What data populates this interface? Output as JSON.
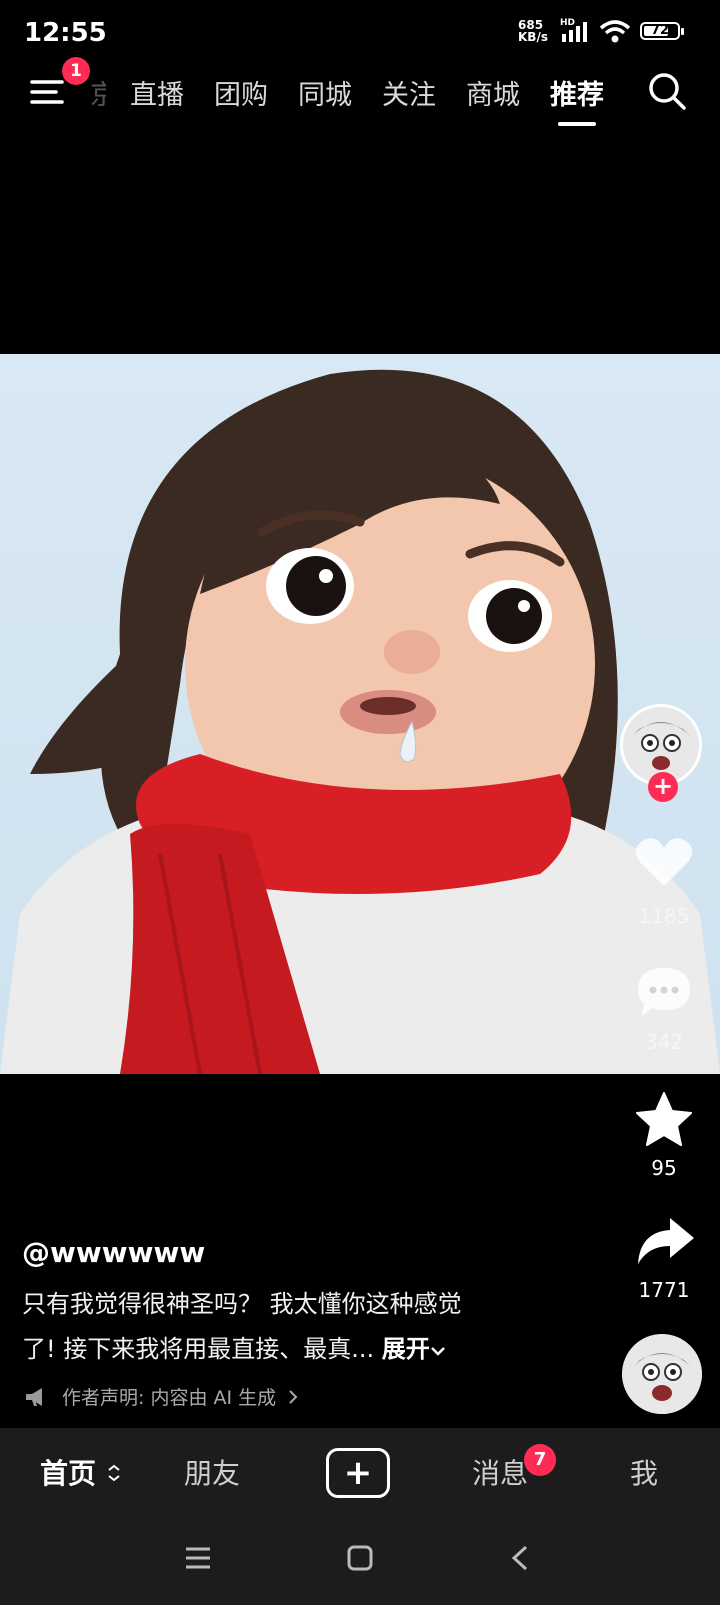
{
  "status": {
    "time": "12:55",
    "net_speed_top": "685",
    "net_speed_bottom": "KB/s",
    "hd": "HD",
    "battery": "72"
  },
  "top_nav": {
    "menu_badge": "1",
    "tabs": [
      {
        "label": "京"
      },
      {
        "label": "直播"
      },
      {
        "label": "团购"
      },
      {
        "label": "同城"
      },
      {
        "label": "关注"
      },
      {
        "label": "商城"
      },
      {
        "label": "推荐"
      }
    ]
  },
  "rail": {
    "likes": "1185",
    "comments": "342",
    "favorites": "95",
    "shares": "1771"
  },
  "post": {
    "username": "@wwwwww",
    "caption_line1": "只有我觉得很神圣吗？ 我太懂你这种感觉",
    "caption_line2": "了! 接下来我将用最直接、最真...",
    "expand": "展开",
    "declaration": "作者声明: 内容由 AI 生成"
  },
  "bottom_nav": {
    "home": "首页",
    "friends": "朋友",
    "messages": "消息",
    "messages_badge": "7",
    "me": "我"
  },
  "colors": {
    "accent": "#fe2c55",
    "scarf": "#d81f26",
    "sky": "#d8e8f4"
  }
}
